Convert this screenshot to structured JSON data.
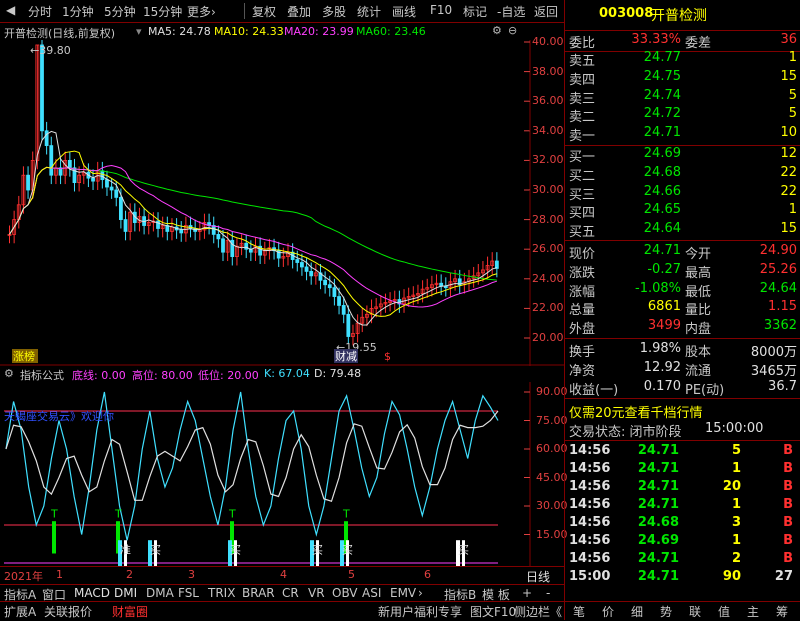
{
  "toolbar": {
    "tabs": [
      "分时",
      "1分钟",
      "5分钟",
      "15分钟",
      "更多›"
    ],
    "actions": [
      "复权",
      "叠加",
      "多股",
      "统计",
      "画线",
      "F10",
      "标记",
      "-自选",
      "返回"
    ]
  },
  "info": {
    "stock_title": "开普检测(日线,前复权)",
    "ma5": "MA5: 24.78",
    "ma10": "MA10: 24.33",
    "ma20": "MA20: 23.99",
    "ma60": "MA60: 23.46"
  },
  "price_axis": [
    "40.00",
    "38.00",
    "36.00",
    "34.00",
    "32.00",
    "30.00",
    "28.00",
    "26.00",
    "24.00",
    "22.00",
    "20.00"
  ],
  "annotations": {
    "high": "39.80",
    "low": "19.55",
    "tag_left": "涨榜",
    "tag_low": "财减",
    "dollar": "$"
  },
  "indicator": {
    "name": "指标公式",
    "bottom_line": "底线: 0.00",
    "high_pos": "高位: 80.00",
    "low_pos": "低位: 20.00",
    "k": "K: 67.04",
    "d": "D: 79.48",
    "banner": "天蝎座交易云》欢迎你",
    "axis": [
      "90.00",
      "75.00",
      "60.00",
      "45.00",
      "30.00",
      "15.00"
    ],
    "signals": [
      "T",
      "T",
      "T",
      "T"
    ],
    "buy_tags": [
      "准",
      "买",
      "买",
      "买",
      "买",
      "买"
    ]
  },
  "date_axis": [
    "2021年",
    "1",
    "2",
    "3",
    "4",
    "5",
    "6"
  ],
  "date_period": "日线",
  "indicator_tabs": [
    "指标A",
    "窗口",
    "MACD",
    "DMI",
    "DMA",
    "FSL",
    "TRIX",
    "BRAR",
    "CR",
    "VR",
    "OBV",
    "ASI",
    "EMV",
    "›",
    "指标B",
    "模 板",
    "+",
    "-"
  ],
  "bottom_bar": {
    "left": [
      "扩展A",
      "关联报价",
      "财富圈"
    ],
    "right": [
      "新用户福利专享",
      "图文F10",
      "侧边栏《"
    ],
    "panel": [
      "笔",
      "价",
      "细",
      "势",
      "联",
      "值",
      "主",
      "筹"
    ]
  },
  "quote": {
    "code": "003008",
    "name": "开普检测",
    "webi_label": "委比",
    "webi": "33.33%",
    "weicha_label": "委差",
    "weicha": "36",
    "asks": [
      {
        "label": "卖五",
        "price": "24.77",
        "vol": "1"
      },
      {
        "label": "卖四",
        "price": "24.75",
        "vol": "15"
      },
      {
        "label": "卖三",
        "price": "24.74",
        "vol": "5"
      },
      {
        "label": "卖二",
        "price": "24.72",
        "vol": "5"
      },
      {
        "label": "卖一",
        "price": "24.71",
        "vol": "10"
      }
    ],
    "bids": [
      {
        "label": "买一",
        "price": "24.69",
        "vol": "12"
      },
      {
        "label": "买二",
        "price": "24.68",
        "vol": "22"
      },
      {
        "label": "买三",
        "price": "24.66",
        "vol": "22"
      },
      {
        "label": "买四",
        "price": "24.65",
        "vol": "1"
      },
      {
        "label": "买五",
        "price": "24.64",
        "vol": "15"
      }
    ],
    "stats": [
      {
        "l1": "现价",
        "v1": "24.71",
        "c1": "grn",
        "l2": "今开",
        "v2": "24.90",
        "c2": "red"
      },
      {
        "l1": "涨跌",
        "v1": "-0.27",
        "c1": "grn",
        "l2": "最高",
        "v2": "25.26",
        "c2": "red"
      },
      {
        "l1": "涨幅",
        "v1": "-1.08%",
        "c1": "grn",
        "l2": "最低",
        "v2": "24.64",
        "c2": "grn"
      },
      {
        "l1": "总量",
        "v1": "6861",
        "c1": "yel",
        "l2": "量比",
        "v2": "1.15",
        "c2": "red"
      },
      {
        "l1": "外盘",
        "v1": "3499",
        "c1": "red",
        "l2": "内盘",
        "v2": "3362",
        "c2": "grn"
      }
    ],
    "stats2": [
      {
        "l1": "换手",
        "v1": "1.98%",
        "l2": "股本",
        "v2": "8000万"
      },
      {
        "l1": "净资",
        "v1": "12.92",
        "l2": "流通",
        "v2": "3465万"
      },
      {
        "l1": "收益(一)",
        "v1": "0.170",
        "l2": "PE(动)",
        "v2": "36.7"
      }
    ],
    "promo": "仅需20元查看千档行情",
    "trade_status_label": "交易状态: 闭市阶段",
    "trade_status_time": "15:00:00",
    "ticks": [
      {
        "t": "14:56",
        "p": "24.71",
        "pc": "grn",
        "v": "5",
        "bs": "B"
      },
      {
        "t": "14:56",
        "p": "24.71",
        "pc": "grn",
        "v": "1",
        "bs": "B"
      },
      {
        "t": "14:56",
        "p": "24.71",
        "pc": "grn",
        "v": "20",
        "bs": "B"
      },
      {
        "t": "14:56",
        "p": "24.71",
        "pc": "grn",
        "v": "1",
        "bs": "B"
      },
      {
        "t": "14:56",
        "p": "24.68",
        "pc": "grn",
        "v": "3",
        "bs": "B"
      },
      {
        "t": "14:56",
        "p": "24.69",
        "pc": "grn",
        "v": "1",
        "bs": "B"
      },
      {
        "t": "14:56",
        "p": "24.71",
        "pc": "grn",
        "v": "2",
        "bs": "B"
      },
      {
        "t": "15:00",
        "p": "24.71",
        "pc": "grn",
        "v": "90",
        "bs": "27"
      }
    ]
  }
}
